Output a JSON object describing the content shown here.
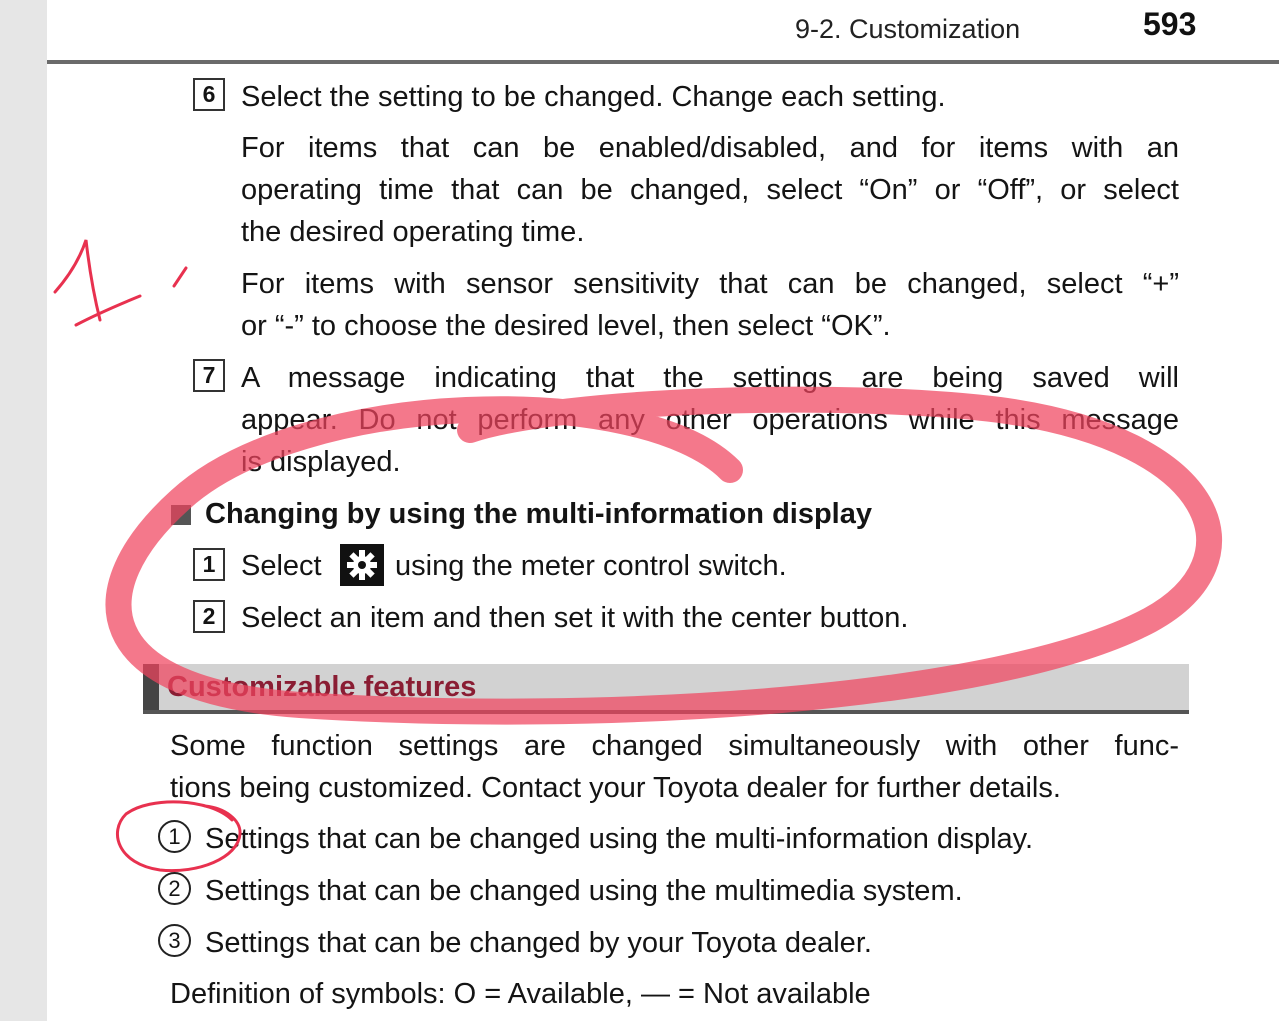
{
  "header": {
    "section": "9-2. Customization",
    "page_number": "593"
  },
  "step6": {
    "num": "6",
    "text": "Select the setting to be changed. Change each setting.",
    "para1": [
      "For items that can be enabled/disabled, and for items with an",
      "operating time that can be changed, select “On” or “Off”, or select",
      "the desired operating time."
    ],
    "para2": [
      "For items with sensor sensitivity that can be changed, select “+”",
      "or “-” to choose the desired level, then select “OK”."
    ]
  },
  "step7": {
    "num": "7",
    "lines": [
      "A message indicating that the settings are being saved will",
      "appear. Do not perform any other operations while this message",
      "is displayed."
    ]
  },
  "mid_section": {
    "heading": "Changing by using the multi-information display",
    "step1": {
      "num": "1",
      "before": "Select",
      "after": "using the meter control switch."
    },
    "step2": {
      "num": "2",
      "text": "Select an item and then set it with the center button."
    }
  },
  "features": {
    "title": "Customizable features",
    "intro": [
      "Some function settings are changed simultaneously with other func-",
      "tions being customized. Contact your Toyota dealer for further details."
    ],
    "items": [
      {
        "num": "1",
        "text": "Settings that can be changed using the multi-information display."
      },
      {
        "num": "2",
        "text": "Settings that can be changed using the multimedia system."
      },
      {
        "num": "3",
        "text": "Settings that can be changed by your Toyota dealer."
      }
    ],
    "definition": "Definition of symbols: O = Available, — = Not available"
  },
  "annotation_colors": {
    "highlight": "#f0445e",
    "pen": "#e8314f"
  }
}
